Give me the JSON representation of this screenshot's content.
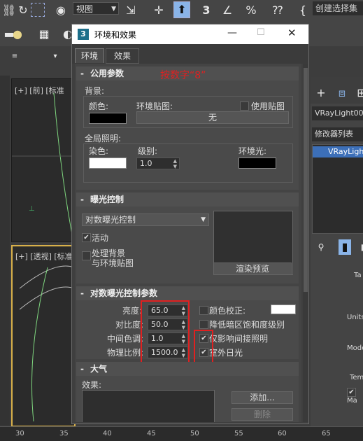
{
  "toolbar": {
    "view_select": "视图",
    "selection_set": "创建选择集",
    "pct_icon": "%"
  },
  "viewports": {
    "top_left_label": "[+] [前] [标准",
    "bottom_left_label": "[+] [透视] [标准"
  },
  "ruler_ticks": [
    "30",
    "35",
    "40",
    "45",
    "50",
    "55",
    "60",
    "65"
  ],
  "right_panel": {
    "object_name": "VRayLight00",
    "modifier_list": "修改器列表",
    "stack_item": "VRayLigh",
    "frag1": "Ta",
    "frag2": "Units",
    "frag3": "Mode",
    "frag4": "Temp",
    "frag5": "Ma"
  },
  "dialog": {
    "icon_text": "3",
    "title": "环境和效果",
    "tabs": [
      "环境",
      "效果"
    ],
    "annotation": "按数字“8”",
    "common": {
      "header": "公用参数",
      "background_label": "背景:",
      "color_label": "颜色:",
      "env_map_label": "环境贴图:",
      "use_map_label": "使用贴图",
      "none_button": "无",
      "global_light_label": "全局照明:",
      "tint_label": "染色:",
      "level_label": "级别:",
      "level_value": "1.0",
      "ambient_label": "环境光:"
    },
    "exposure": {
      "header": "曝光控制",
      "type_value": "对数曝光控制",
      "active_label": "活动",
      "process_bg_label": "处理背景\n与环境贴图",
      "render_preview_button": "渲染预览"
    },
    "log_params": {
      "header": "对数曝光控制参数",
      "brightness_label": "亮度:",
      "brightness_value": "65.0",
      "contrast_label": "对比度:",
      "contrast_value": "50.0",
      "midtones_label": "中间色调:",
      "midtones_value": "1.0",
      "phys_scale_label": "物理比例:",
      "phys_scale_value": "1500.0",
      "color_correction_label": "颜色校正:",
      "desaturate_label": "降低暗区饱和度级别",
      "indirect_only_label": "仅影响间接照明",
      "exterior_daylight_label": "室外日光"
    },
    "atmosphere": {
      "header": "大气",
      "effects_label": "效果:",
      "add_button": "添加...",
      "delete_button": "删除"
    }
  },
  "colors": {
    "annotation_red": "#e02020",
    "selection_blue": "#3c6fb8"
  }
}
